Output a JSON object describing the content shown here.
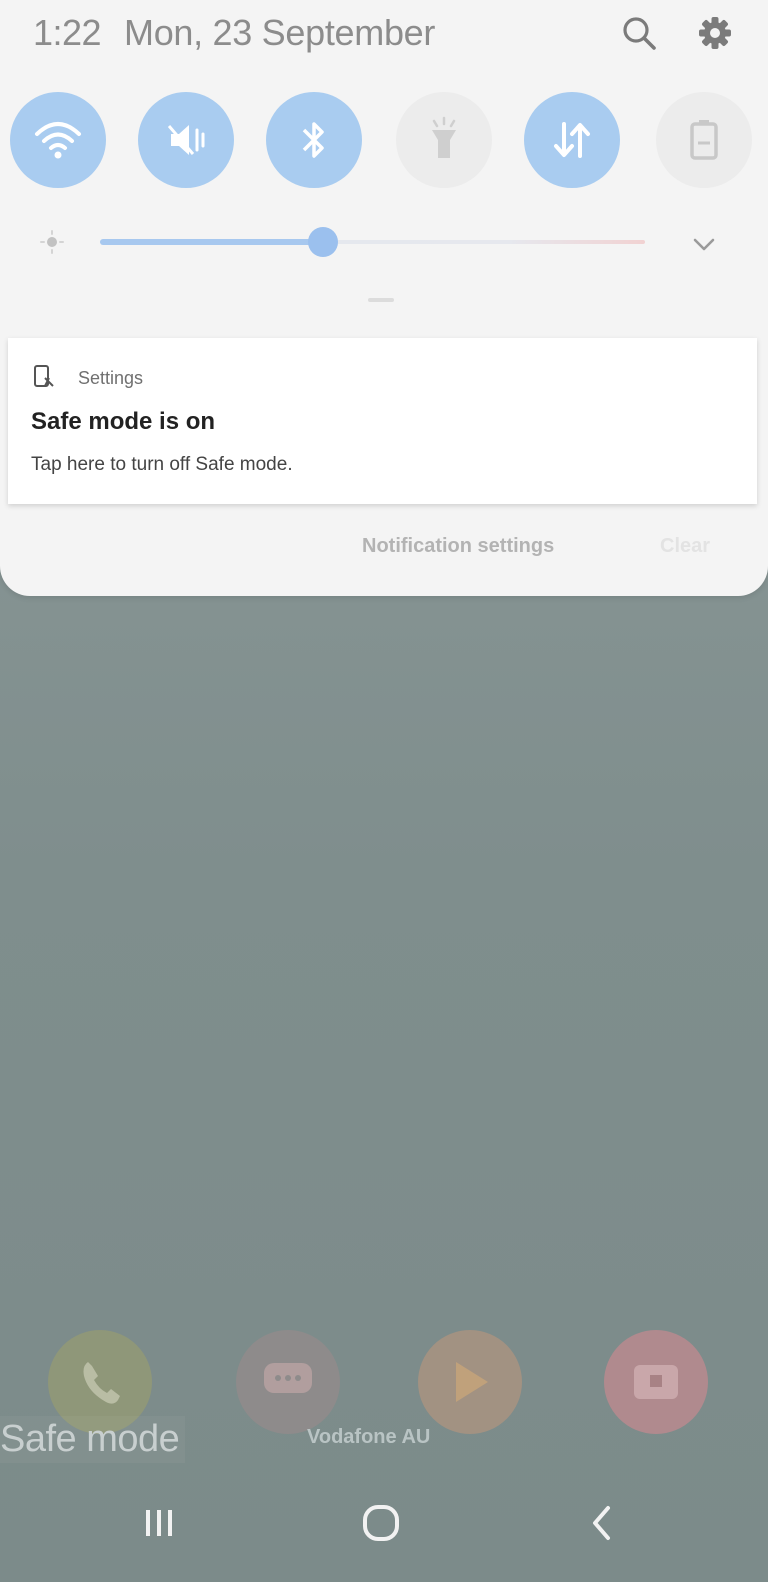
{
  "status": {
    "time": "1:22",
    "date": "Mon, 23 September"
  },
  "quick_settings": [
    {
      "name": "wifi",
      "icon": "wifi-icon",
      "state": "on"
    },
    {
      "name": "mute",
      "icon": "mute-vibrate-icon",
      "state": "on"
    },
    {
      "name": "bluetooth",
      "icon": "bluetooth-icon",
      "state": "on"
    },
    {
      "name": "flashlight",
      "icon": "flashlight-icon",
      "state": "off"
    },
    {
      "name": "mobile-data",
      "icon": "data-transfer-icon",
      "state": "on"
    },
    {
      "name": "battery-saver",
      "icon": "battery-icon",
      "state": "off"
    }
  ],
  "brightness": {
    "level": 0.41
  },
  "notification": {
    "app_name": "Settings",
    "title": "Safe mode is on",
    "text": "Tap here to turn off Safe mode."
  },
  "actions": {
    "notification_settings": "Notification settings",
    "clear": "Clear"
  },
  "home": {
    "safe_mode_label": "Safe mode",
    "carrier": "Vodafone AU"
  },
  "colors": {
    "tile_on": "#a9ccf0",
    "tile_off": "#ececec",
    "slider_accent": "#9bc0ee",
    "shade_background": "#f4f4f4",
    "wallpaper": "#7f8e8d"
  }
}
